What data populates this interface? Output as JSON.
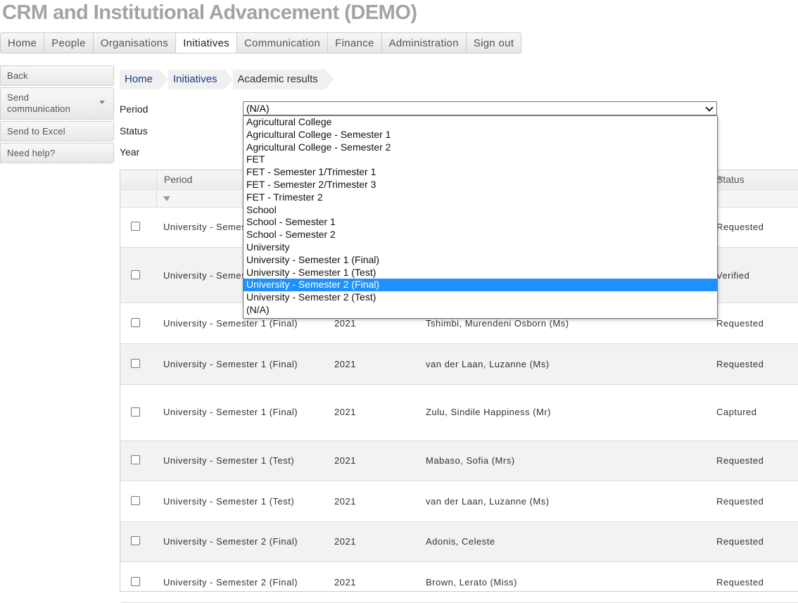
{
  "app": {
    "title": "CRM and Institutional Advancement (DEMO)"
  },
  "nav": [
    {
      "label": "Home"
    },
    {
      "label": "People"
    },
    {
      "label": "Organisations"
    },
    {
      "label": "Initiatives",
      "active": true
    },
    {
      "label": "Communication"
    },
    {
      "label": "Finance"
    },
    {
      "label": "Administration"
    },
    {
      "label": "Sign out"
    }
  ],
  "side_actions": {
    "back": "Back",
    "send_communication": "Send communication",
    "send_to_excel": "Send to Excel",
    "need_help": "Need help?"
  },
  "breadcrumb": [
    "Home",
    "Initiatives",
    "Academic results"
  ],
  "filters": {
    "period_label": "Period",
    "status_label": "Status",
    "year_label": "Year",
    "period_value": "(N/A)"
  },
  "dropdown": {
    "options": [
      "Agricultural College",
      "Agricultural College - Semester 1",
      "Agricultural College - Semester 2",
      "FET",
      "FET - Semester 1/Trimester 1",
      "FET - Semester 2/Trimester 3",
      "FET - Trimester 2",
      "School",
      "School - Semester 1",
      "School - Semester 2",
      "University",
      "University - Semester 1 (Final)",
      "University - Semester 1 (Test)",
      "University - Semester 2 (Final)",
      "University - Semester 2 (Test)",
      "(N/A)"
    ],
    "highlighted": "University - Semester 2 (Final)"
  },
  "grid": {
    "headers": {
      "period": "Period",
      "status": "Status"
    },
    "rows": [
      {
        "period": "University - Semes",
        "year": "",
        "person": "",
        "status": "Requested"
      },
      {
        "period": "University - Semes",
        "year": "",
        "person": "",
        "status": "Verified"
      },
      {
        "period": "University - Semester 1 (Final)",
        "year": "2021",
        "person": "Tshimbi, Murendeni Osborn (Ms)",
        "status": "Requested"
      },
      {
        "period": "University - Semester 1 (Final)",
        "year": "2021",
        "person": "van der Laan, Luzanne (Ms)",
        "status": "Requested"
      },
      {
        "period": "University - Semester 1 (Final)",
        "year": "2021",
        "person": "Zulu, Sindile Happiness (Mr)",
        "status": "Captured"
      },
      {
        "period": "University - Semester 1 (Test)",
        "year": "2021",
        "person": "Mabaso, Sofia (Mrs)",
        "status": "Requested"
      },
      {
        "period": "University - Semester 1 (Test)",
        "year": "2021",
        "person": "van der Laan, Luzanne (Ms)",
        "status": "Requested"
      },
      {
        "period": "University - Semester 2 (Final)",
        "year": "2021",
        "person": "Adonis, Celeste",
        "status": "Requested"
      },
      {
        "period": "University - Semester 2 (Final)",
        "year": "2021",
        "person": "Brown, Lerato (Miss)",
        "status": "Requested"
      }
    ]
  }
}
